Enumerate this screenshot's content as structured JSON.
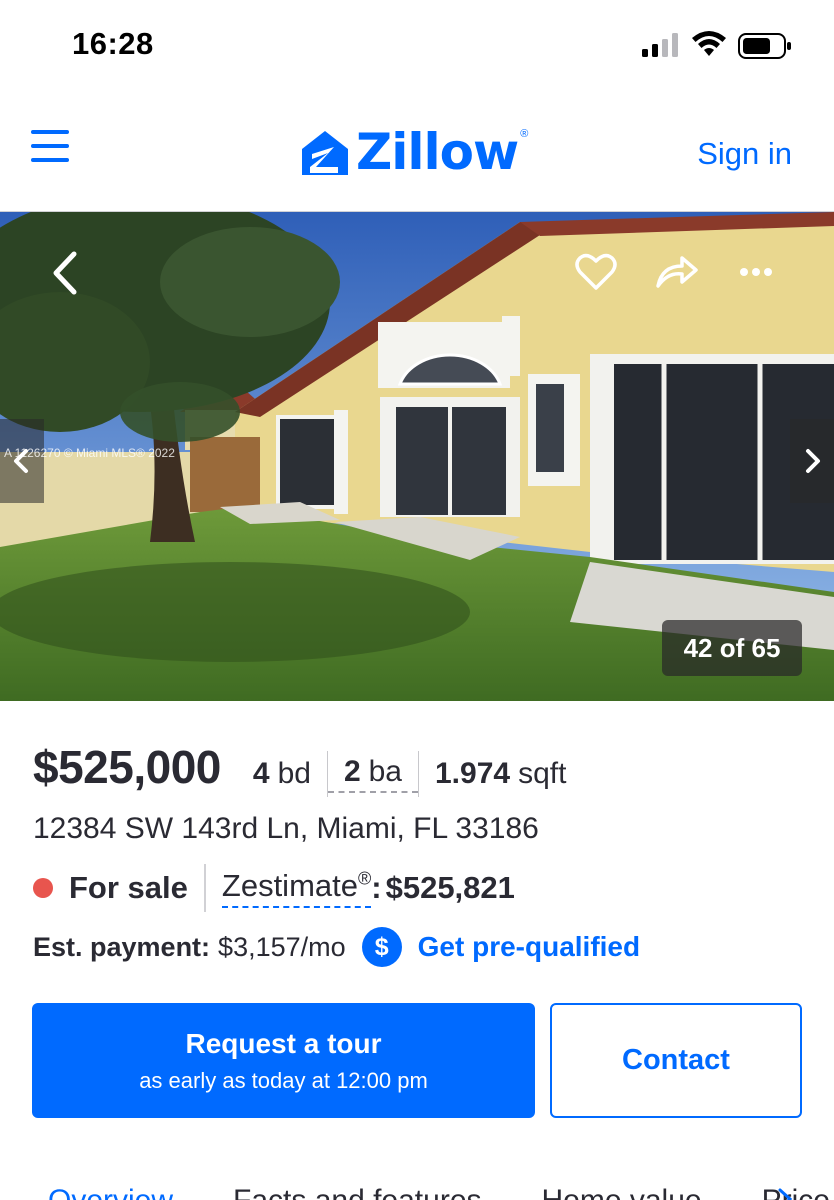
{
  "status_bar": {
    "time": "16:28"
  },
  "header": {
    "logo_text": "Zillow",
    "logo_reg": "®",
    "sign_in": "Sign in",
    "brand_color": "#006aff"
  },
  "photo": {
    "counter": "42 of 65",
    "watermark": "A 1126270 © Miami MLS® 2022",
    "icons": [
      "back-icon",
      "heart-icon",
      "share-icon",
      "more-icon",
      "chevron-left-icon",
      "chevron-right-icon"
    ]
  },
  "listing": {
    "price": "$525,000",
    "beds_value": "4",
    "beds_unit": "bd",
    "baths_value": "2",
    "baths_unit": "ba",
    "sqft_value": "1.974",
    "sqft_unit": "sqft",
    "address": "12384 SW 143rd Ln, Miami, FL 33186",
    "status": "For sale",
    "status_color": "#e8554e",
    "zestimate_label": "Zestimate",
    "zestimate_reg": "®",
    "zestimate_colon": ":",
    "zestimate_value": "$525,821",
    "payment_label": "Est. payment:",
    "payment_value": "$3,157/mo",
    "dollar_symbol": "$",
    "prequal_link": "Get pre-qualified"
  },
  "actions": {
    "tour_title": "Request a tour",
    "tour_subtitle": "as early as today at 12:00 pm",
    "contact": "Contact"
  },
  "tabs": [
    "Overview",
    "Facts and features",
    "Home value",
    "Price"
  ]
}
